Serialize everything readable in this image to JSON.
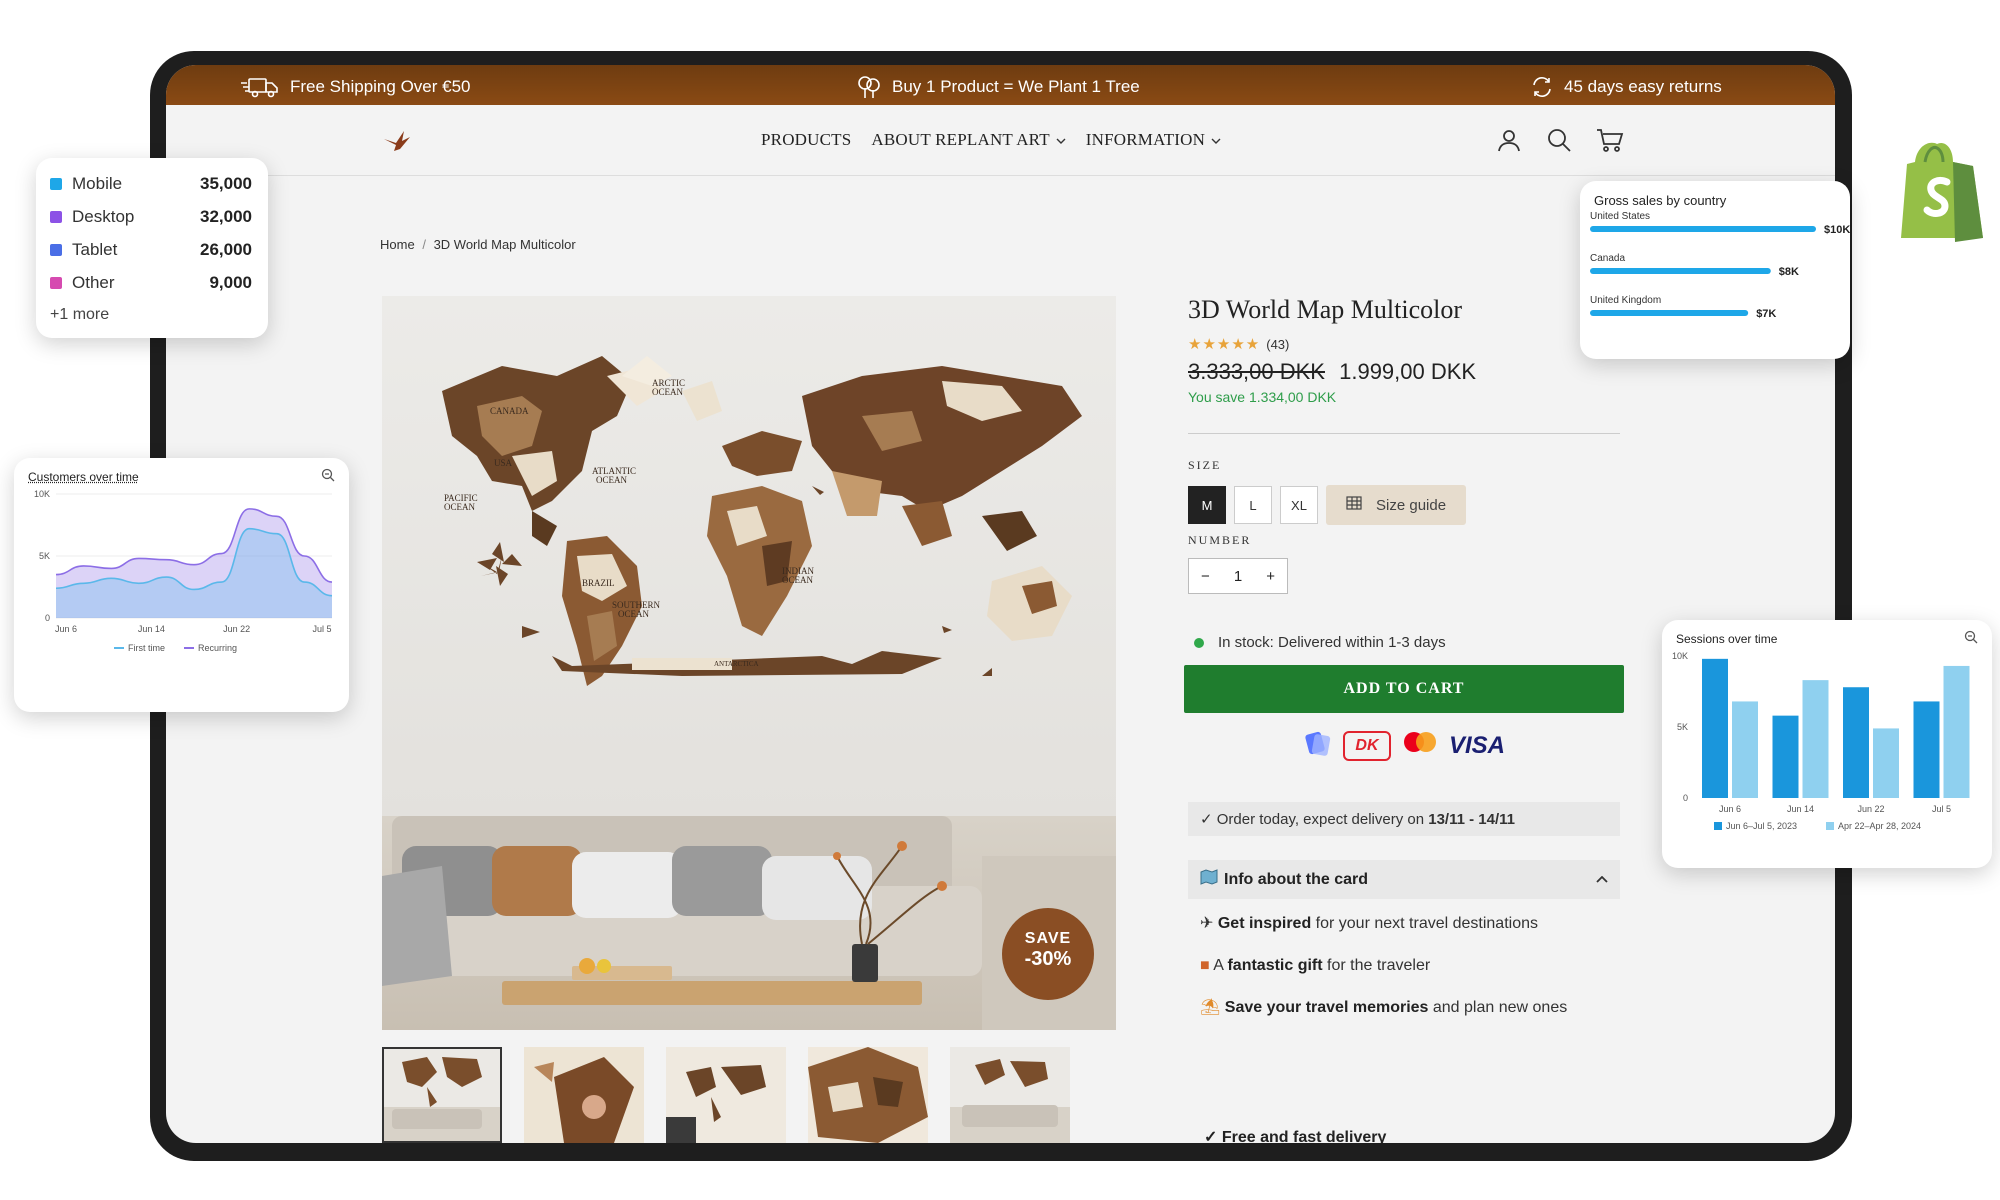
{
  "topbar": {
    "shipping": "Free Shipping Over €50",
    "tree": "Buy 1 Product = We Plant 1 Tree",
    "returns": "45 days easy returns"
  },
  "nav": {
    "products": "PRODUCTS",
    "about": "ABOUT REPLANT ART",
    "information": "INFORMATION"
  },
  "breadcrumb": {
    "home": "Home",
    "sep": "/",
    "current": "3D World Map Multicolor"
  },
  "hero": {
    "save_line1": "SAVE",
    "save_line2": "-30%",
    "map_labels": [
      "CANADA",
      "USA",
      "ARCTIC OCEAN",
      "ATLANTIC OCEAN",
      "PACIFIC OCEAN",
      "BRAZIL",
      "INDIAN OCEAN",
      "SOUTHERN OCEAN",
      "ANTARCTICA"
    ]
  },
  "product": {
    "title": "3D World Map Multicolor",
    "rating_count": "(43)",
    "stars": "★★★★★",
    "old_price": "3.333,00 DKK",
    "price": "1.999,00 DKK",
    "you_save": "You save 1.334,00 DKK",
    "size_label": "SIZE",
    "sizes": [
      "M",
      "L",
      "XL"
    ],
    "selected_size": "M",
    "size_guide": "Size guide",
    "number_label": "NUMBER",
    "qty_minus": "−",
    "qty_value": "1",
    "qty_plus": "+",
    "stock": "In stock: Delivered within 1-3 days",
    "add_to_cart": "ADD TO CART",
    "payment_visa": "VISA",
    "payment_dk": "DK",
    "order_prefix": "✓ Order today, expect delivery on ",
    "order_dates": "13/11 - 14/11",
    "accordion_title": "Info about the card",
    "feature1_bold": "Get inspired",
    "feature1_rest": " for your next travel destinations",
    "feature2_pre": "A ",
    "feature2_bold": "fantastic gift",
    "feature2_rest": " for the traveler",
    "feature3_bold": "Save your travel memories",
    "feature3_rest": " and plan new ones",
    "bottom_check": "✓  Free and fast delivery"
  },
  "devices_card": {
    "rows": [
      {
        "label": "Mobile",
        "value": "35,000",
        "color": "#1ea7e8"
      },
      {
        "label": "Desktop",
        "value": "32,000",
        "color": "#8c52e6"
      },
      {
        "label": "Tablet",
        "value": "26,000",
        "color": "#4a6ee6"
      },
      {
        "label": "Other",
        "value": "9,000",
        "color": "#d64ab0"
      }
    ],
    "more": "+1 more"
  },
  "customers_card": {
    "title": "Customers over time"
  },
  "gross_card": {
    "title": "Gross sales by country"
  },
  "sessions_card": {
    "title": "Sessions over time"
  },
  "chart_data": [
    {
      "type": "area",
      "title": "Customers over time",
      "x": [
        "Jun 6",
        "Jun 14",
        "Jun 22",
        "Jul 5"
      ],
      "yticks": [
        "10K",
        "5K",
        "0"
      ],
      "ylim": [
        0,
        10000
      ],
      "series": [
        {
          "name": "First time",
          "color": "#5ab8ea",
          "values": [
            2400,
            2800,
            3200,
            2800,
            3300,
            2300,
            2900,
            7200,
            6800,
            2900,
            1800
          ]
        },
        {
          "name": "Recurring",
          "color": "#8c6ee6",
          "values": [
            3500,
            4200,
            4000,
            4800,
            4700,
            4300,
            5200,
            8800,
            8200,
            5000,
            2900
          ]
        }
      ]
    },
    {
      "type": "bar",
      "title": "Gross sales by country",
      "categories": [
        "United States",
        "Canada",
        "United Kingdom"
      ],
      "values": [
        10,
        8,
        7
      ],
      "value_labels": [
        "$10K",
        "$8K",
        "$7K"
      ],
      "color": "#1ea7e8"
    },
    {
      "type": "bar",
      "title": "Sessions over time",
      "categories": [
        "Jun 6",
        "Jun 14",
        "Jun 22",
        "Jul 5"
      ],
      "yticks": [
        "10K",
        "5K",
        "0"
      ],
      "ylim": [
        0,
        10000
      ],
      "series": [
        {
          "name": "Jun 6–Jul 5, 2023",
          "color": "#1a96dc",
          "values": [
            9800,
            5800,
            7800,
            6800
          ]
        },
        {
          "name": "Apr 22–Apr 28, 2024",
          "color": "#8fd0ef",
          "values": [
            6800,
            8300,
            4900,
            9300
          ]
        }
      ]
    }
  ]
}
